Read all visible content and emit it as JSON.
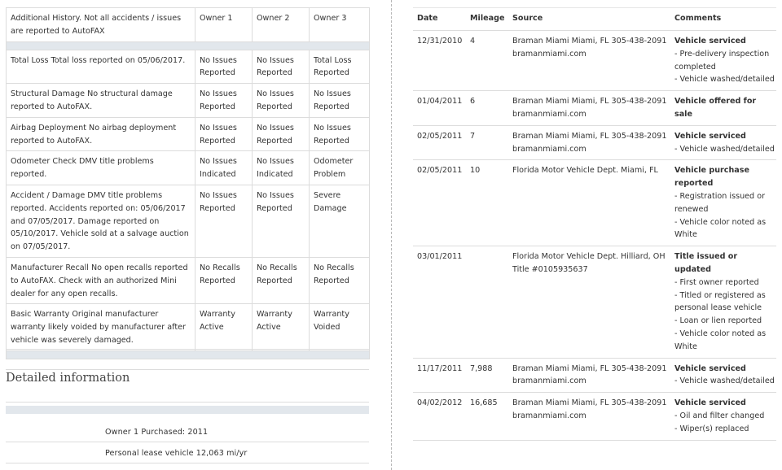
{
  "summary": {
    "header": {
      "description": "Additional History. Not all accidents / issues are reported to AutoFAX",
      "owners": [
        "Owner 1",
        "Owner 2",
        "Owner 3"
      ]
    },
    "rows": [
      {
        "description": "Total Loss Total loss reported on 05/06/2017.",
        "values": [
          "No Issues Reported",
          "No Issues Reported",
          "Total Loss Reported"
        ]
      },
      {
        "description": "Structural Damage No structural damage reported to AutoFAX.",
        "values": [
          "No Issues Reported",
          "No Issues Reported",
          "No Issues Reported"
        ]
      },
      {
        "description": "Airbag Deployment No airbag deployment reported to AutoFAX.",
        "values": [
          "No Issues Reported",
          "No Issues Reported",
          "No Issues Reported"
        ]
      },
      {
        "description": "Odometer Check DMV title problems reported.",
        "values": [
          "No Issues Indicated",
          "No Issues Indicated",
          "Odometer Problem"
        ]
      },
      {
        "description": "Accident / Damage DMV title problems reported. Accidents reported on: 05/06/2017 and 07/05/2017. Damage reported on 05/10/2017. Vehicle sold at a salvage auction on 07/05/2017.",
        "values": [
          "No Issues Reported",
          "No Issues Reported",
          "Severe Damage"
        ]
      },
      {
        "description": "Manufacturer Recall No open recalls reported to AutoFAX. Check with an authorized Mini dealer for any open recalls.",
        "values": [
          "No Recalls Reported",
          "No Recalls Reported",
          "No Recalls Reported"
        ]
      },
      {
        "description": "Basic Warranty Original manufacturer warranty likely voided by manufacturer after vehicle was severely damaged.",
        "values": [
          "Warranty Active",
          "Warranty Active",
          "Warranty Voided"
        ]
      }
    ]
  },
  "detailed": {
    "title": "Detailed information",
    "lines": [
      "Owner 1 Purchased: 2011",
      "Personal lease vehicle 12,063 mi/yr"
    ]
  },
  "history": {
    "columns": [
      "Date",
      "Mileage",
      "Source",
      "Comments"
    ],
    "rows": [
      {
        "date": "12/31/2010",
        "mileage": "4",
        "source": [
          "Braman Miami Miami, FL 305-438-2091",
          "bramanmiami.com"
        ],
        "heading": "Vehicle serviced",
        "details": [
          "- Pre-delivery inspection completed",
          "- Vehicle washed/detailed"
        ]
      },
      {
        "date": "01/04/2011",
        "mileage": "6",
        "source": [
          "Braman Miami Miami, FL 305-438-2091",
          "bramanmiami.com"
        ],
        "heading": "Vehicle offered for sale",
        "details": []
      },
      {
        "date": "02/05/2011",
        "mileage": "7",
        "source": [
          "Braman Miami Miami, FL 305-438-2091",
          "bramanmiami.com"
        ],
        "heading": "Vehicle serviced",
        "details": [
          "- Vehicle washed/detailed"
        ]
      },
      {
        "date": "02/05/2011",
        "mileage": "10",
        "source": [
          "Florida Motor Vehicle Dept. Miami, FL"
        ],
        "heading": "Vehicle purchase reported",
        "details": [
          "- Registration issued or renewed",
          "- Vehicle color noted as White"
        ]
      },
      {
        "date": "03/01/2011",
        "mileage": "",
        "source": [
          "Florida Motor Vehicle Dept. Hilliard, OH",
          "Title #0105935637"
        ],
        "heading": "Title issued or updated",
        "details": [
          "- First owner reported",
          "- Titled or registered as personal lease vehicle",
          "- Loan or lien reported",
          "- Vehicle color noted as White"
        ]
      },
      {
        "date": "11/17/2011",
        "mileage": "7,988",
        "source": [
          "Braman Miami Miami, FL 305-438-2091",
          "bramanmiami.com"
        ],
        "heading": "Vehicle serviced",
        "details": [
          "- Vehicle washed/detailed"
        ]
      },
      {
        "date": "04/02/2012",
        "mileage": "16,685",
        "source": [
          "Braman Miami Miami, FL 305-438-2091",
          "bramanmiami.com"
        ],
        "heading": "Vehicle serviced",
        "details": [
          "- Oil and filter changed",
          "- Wiper(s) replaced"
        ]
      }
    ]
  }
}
